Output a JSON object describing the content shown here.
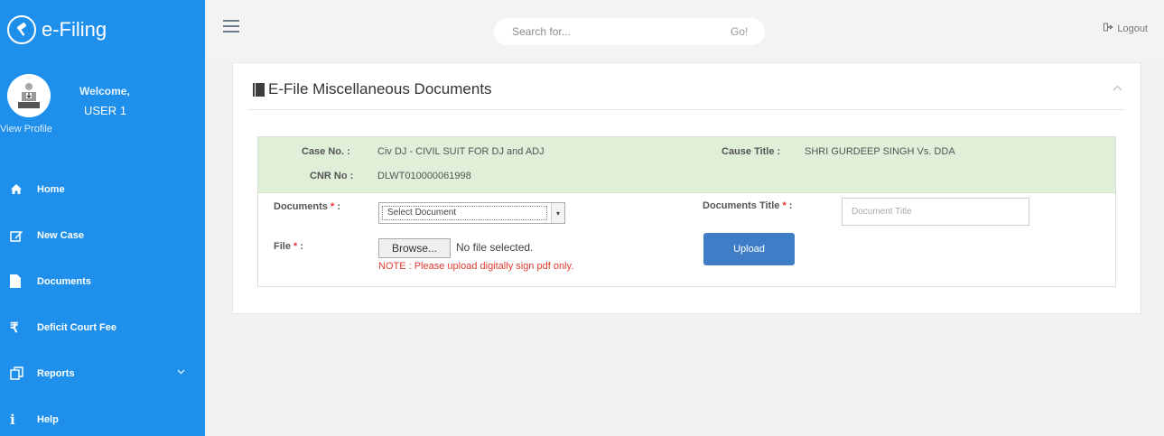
{
  "brand": {
    "name": "e-Filing"
  },
  "profile": {
    "welcome": "Welcome,",
    "username": "USER 1",
    "view_profile": "View Profile"
  },
  "nav": [
    {
      "label": "Home",
      "icon": "home-icon"
    },
    {
      "label": "New Case",
      "icon": "edit-icon"
    },
    {
      "label": "Documents",
      "icon": "file-icon"
    },
    {
      "label": "Deficit Court Fee",
      "icon": "rupee-icon"
    },
    {
      "label": "Reports",
      "icon": "copy-icon"
    },
    {
      "label": "Help",
      "icon": "info-icon"
    }
  ],
  "topbar": {
    "search_placeholder": "Search for...",
    "search_go": "Go!",
    "logout": "Logout"
  },
  "panel": {
    "title": "E-File Miscellaneous Documents",
    "case": {
      "case_no_label": "Case No. :",
      "case_no_value": "Civ DJ - CIVIL SUIT FOR DJ and ADJ",
      "cnr_label": "CNR No :",
      "cnr_value": "DLWT010000061998",
      "cause_title_label": "Cause Title :",
      "cause_title_value": "SHRI GURDEEP SINGH Vs. DDA"
    },
    "form": {
      "documents_label": "Documents",
      "documents_selected": "Select Document",
      "doc_title_label": "Documents Title",
      "doc_title_placeholder": "Document Title",
      "file_label": "File",
      "browse_label": "Browse...",
      "file_status": "No file selected.",
      "note": "NOTE : Please upload digitally sign pdf only.",
      "upload_label": "Upload",
      "required_mark": "*",
      "colon": ":"
    }
  },
  "colors": {
    "sidebar": "#1e90ec",
    "upload": "#3f7ec6",
    "case_info_bg": "#dfefd8",
    "note": "#e03a2e"
  }
}
